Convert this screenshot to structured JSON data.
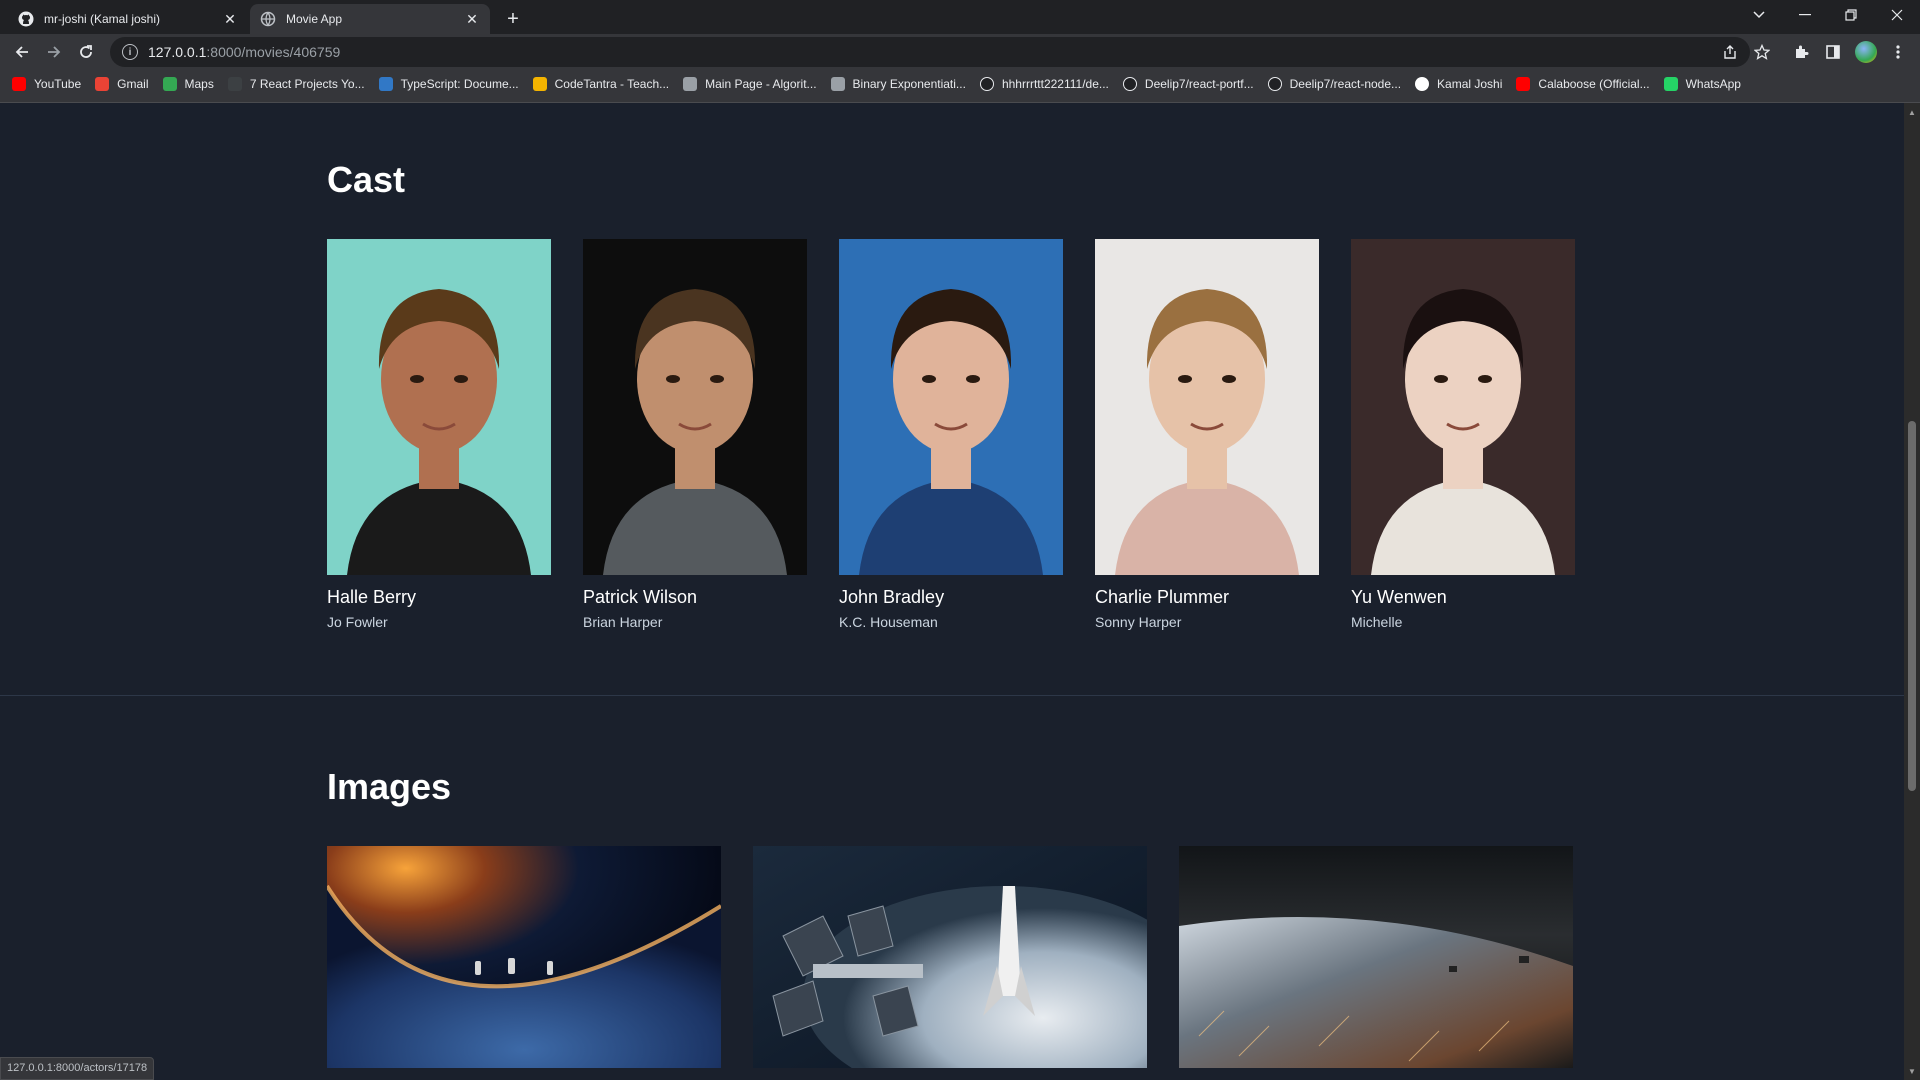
{
  "browser": {
    "tabs": [
      {
        "title": "mr-joshi (Kamal joshi)",
        "close": "✕",
        "active": false
      },
      {
        "title": "Movie App",
        "close": "✕",
        "active": true
      }
    ],
    "new_tab": "+",
    "url_host": "127.0.0.1",
    "url_path": ":8000/movies/406759",
    "bookmarks": [
      {
        "label": "YouTube",
        "icon": "youtube-icon",
        "color": "#ff0000"
      },
      {
        "label": "Gmail",
        "icon": "gmail-icon",
        "color": "#ea4335"
      },
      {
        "label": "Maps",
        "icon": "maps-icon",
        "color": "#34a853"
      },
      {
        "label": "7 React Projects Yo...",
        "icon": "react-projects-icon",
        "color": "#3c4043"
      },
      {
        "label": "TypeScript: Docume...",
        "icon": "typescript-icon",
        "color": "#3178c6"
      },
      {
        "label": "CodeTantra - Teach...",
        "icon": "codetantra-icon",
        "color": "#f4b400"
      },
      {
        "label": "Main Page - Algorit...",
        "icon": "algorithmica-icon",
        "color": "#9aa0a6"
      },
      {
        "label": "Binary Exponentiati...",
        "icon": "cp-algorithms-icon",
        "color": "#9aa0a6"
      },
      {
        "label": "hhhrrrttt222111/de...",
        "icon": "github-icon",
        "color": "#ffffff"
      },
      {
        "label": "Deelip7/react-portf...",
        "icon": "github-icon",
        "color": "#ffffff"
      },
      {
        "label": "Deelip7/react-node...",
        "icon": "github-icon",
        "color": "#ffffff"
      },
      {
        "label": "Kamal Joshi",
        "icon": "vercel-icon",
        "color": "#000000"
      },
      {
        "label": "Calaboose (Official...",
        "icon": "youtube-icon",
        "color": "#ff0000"
      },
      {
        "label": "WhatsApp",
        "icon": "whatsapp-icon",
        "color": "#25d366"
      }
    ],
    "status_url": "127.0.0.1:8000/actors/17178"
  },
  "cast": {
    "heading": "Cast",
    "members": [
      {
        "name": "Halle Berry",
        "character": "Jo Fowler",
        "bg": "#7fd3c8",
        "skin": "#b07050",
        "hair": "#5a3a1a",
        "cloth": "#1a1a1a"
      },
      {
        "name": "Patrick Wilson",
        "character": "Brian Harper",
        "bg": "#0d0d0d",
        "skin": "#c08f6e",
        "hair": "#4a3420",
        "cloth": "#555a5e"
      },
      {
        "name": "John Bradley",
        "character": "K.C. Houseman",
        "bg": "#2d6fb5",
        "skin": "#e0b39a",
        "hair": "#2a1a10",
        "cloth": "#1e3f73"
      },
      {
        "name": "Charlie Plummer",
        "character": "Sonny Harper",
        "bg": "#e9e7e5",
        "skin": "#e6c2a8",
        "hair": "#9a7040",
        "cloth": "#d9b3a7"
      },
      {
        "name": "Yu Wenwen",
        "character": "Michelle",
        "bg": "#3a2a2a",
        "skin": "#ecd2c2",
        "hair": "#1a1010",
        "cloth": "#e8e3dc"
      }
    ]
  },
  "images": {
    "heading": "Images",
    "stills": [
      "moon-astronauts-still",
      "space-station-still",
      "earth-orbit-still"
    ]
  }
}
